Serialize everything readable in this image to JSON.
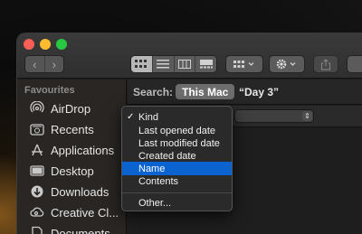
{
  "sidebar": {
    "header": "Favourites",
    "items": [
      {
        "label": "AirDrop",
        "icon": "airdrop-icon"
      },
      {
        "label": "Recents",
        "icon": "clock-icon"
      },
      {
        "label": "Applications",
        "icon": "applications-icon"
      },
      {
        "label": "Desktop",
        "icon": "desktop-icon"
      },
      {
        "label": "Downloads",
        "icon": "download-icon"
      },
      {
        "label": "Creative Cl...",
        "icon": "creative-cloud-icon"
      },
      {
        "label": "Documents",
        "icon": "documents-icon"
      }
    ]
  },
  "toolbar": {
    "back_glyph": "‹",
    "forward_glyph": "›",
    "view_modes": [
      "icon-view",
      "list-view",
      "column-view",
      "gallery-view"
    ],
    "active_view": "icon-view"
  },
  "search": {
    "label": "Search:",
    "scope_active": "This Mac",
    "scope_other": "“Day 3”"
  },
  "attribute_menu": {
    "items": [
      {
        "label": "Kind",
        "checked": true
      },
      {
        "label": "Last opened date"
      },
      {
        "label": "Last modified date"
      },
      {
        "label": "Created date"
      },
      {
        "label": "Name",
        "selected": true
      },
      {
        "label": "Contents"
      }
    ],
    "other": "Other...",
    "check_glyph": "✓"
  },
  "colors": {
    "accent": "#0a63cf",
    "close": "#ff5f57",
    "minimize": "#febc2e",
    "zoom": "#28c840"
  }
}
